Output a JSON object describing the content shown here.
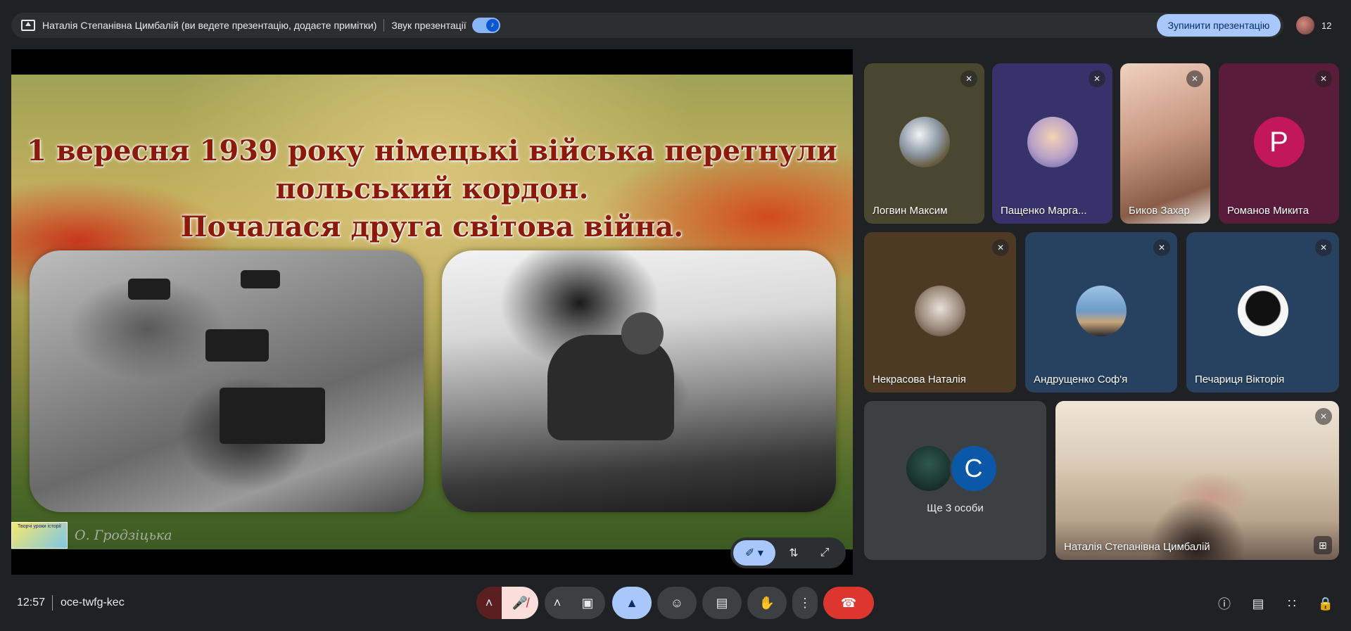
{
  "banner": {
    "presenting_text": "Наталія Степанівна Цимбалій (ви ведете презентацію, додаєте примітки)",
    "sound_label": "Звук презентації",
    "stop_button": "Зупинити презентацію",
    "participant_count": "12"
  },
  "slide": {
    "title_line1": "1 вересня 1939 року німецькі війська перетнули",
    "title_line2": "польський кордон.",
    "title_line3": "Почалася друга світова війна.",
    "author": "О. Гродзіцька",
    "badge_text": "Творчі уроки історії"
  },
  "participants": [
    {
      "name": "Логвин Максим",
      "muted": true
    },
    {
      "name": "Пащенко Марга...",
      "muted": true
    },
    {
      "name": "Биков Захар",
      "muted": true
    },
    {
      "name": "Романов Микита",
      "muted": true,
      "letter": "Р"
    },
    {
      "name": "Некрасова Наталія",
      "muted": true
    },
    {
      "name": "Андрущенко Соф'я",
      "muted": true
    },
    {
      "name": "Печариця Вікторія",
      "muted": true
    }
  ],
  "more_tile": {
    "label": "Ще 3 особи",
    "letter": "C"
  },
  "host_tile": {
    "name": "Наталія Степанівна Цимбалій"
  },
  "bottom": {
    "time": "12:57",
    "meeting_code": "oce-twfg-kec"
  },
  "colors": {
    "accent": "#a8c7fa",
    "leave": "#dc362e",
    "mic_off_bg": "#f9dedc",
    "title_text": "#8c1a0a",
    "romanov_avatar": "#c2185b"
  }
}
